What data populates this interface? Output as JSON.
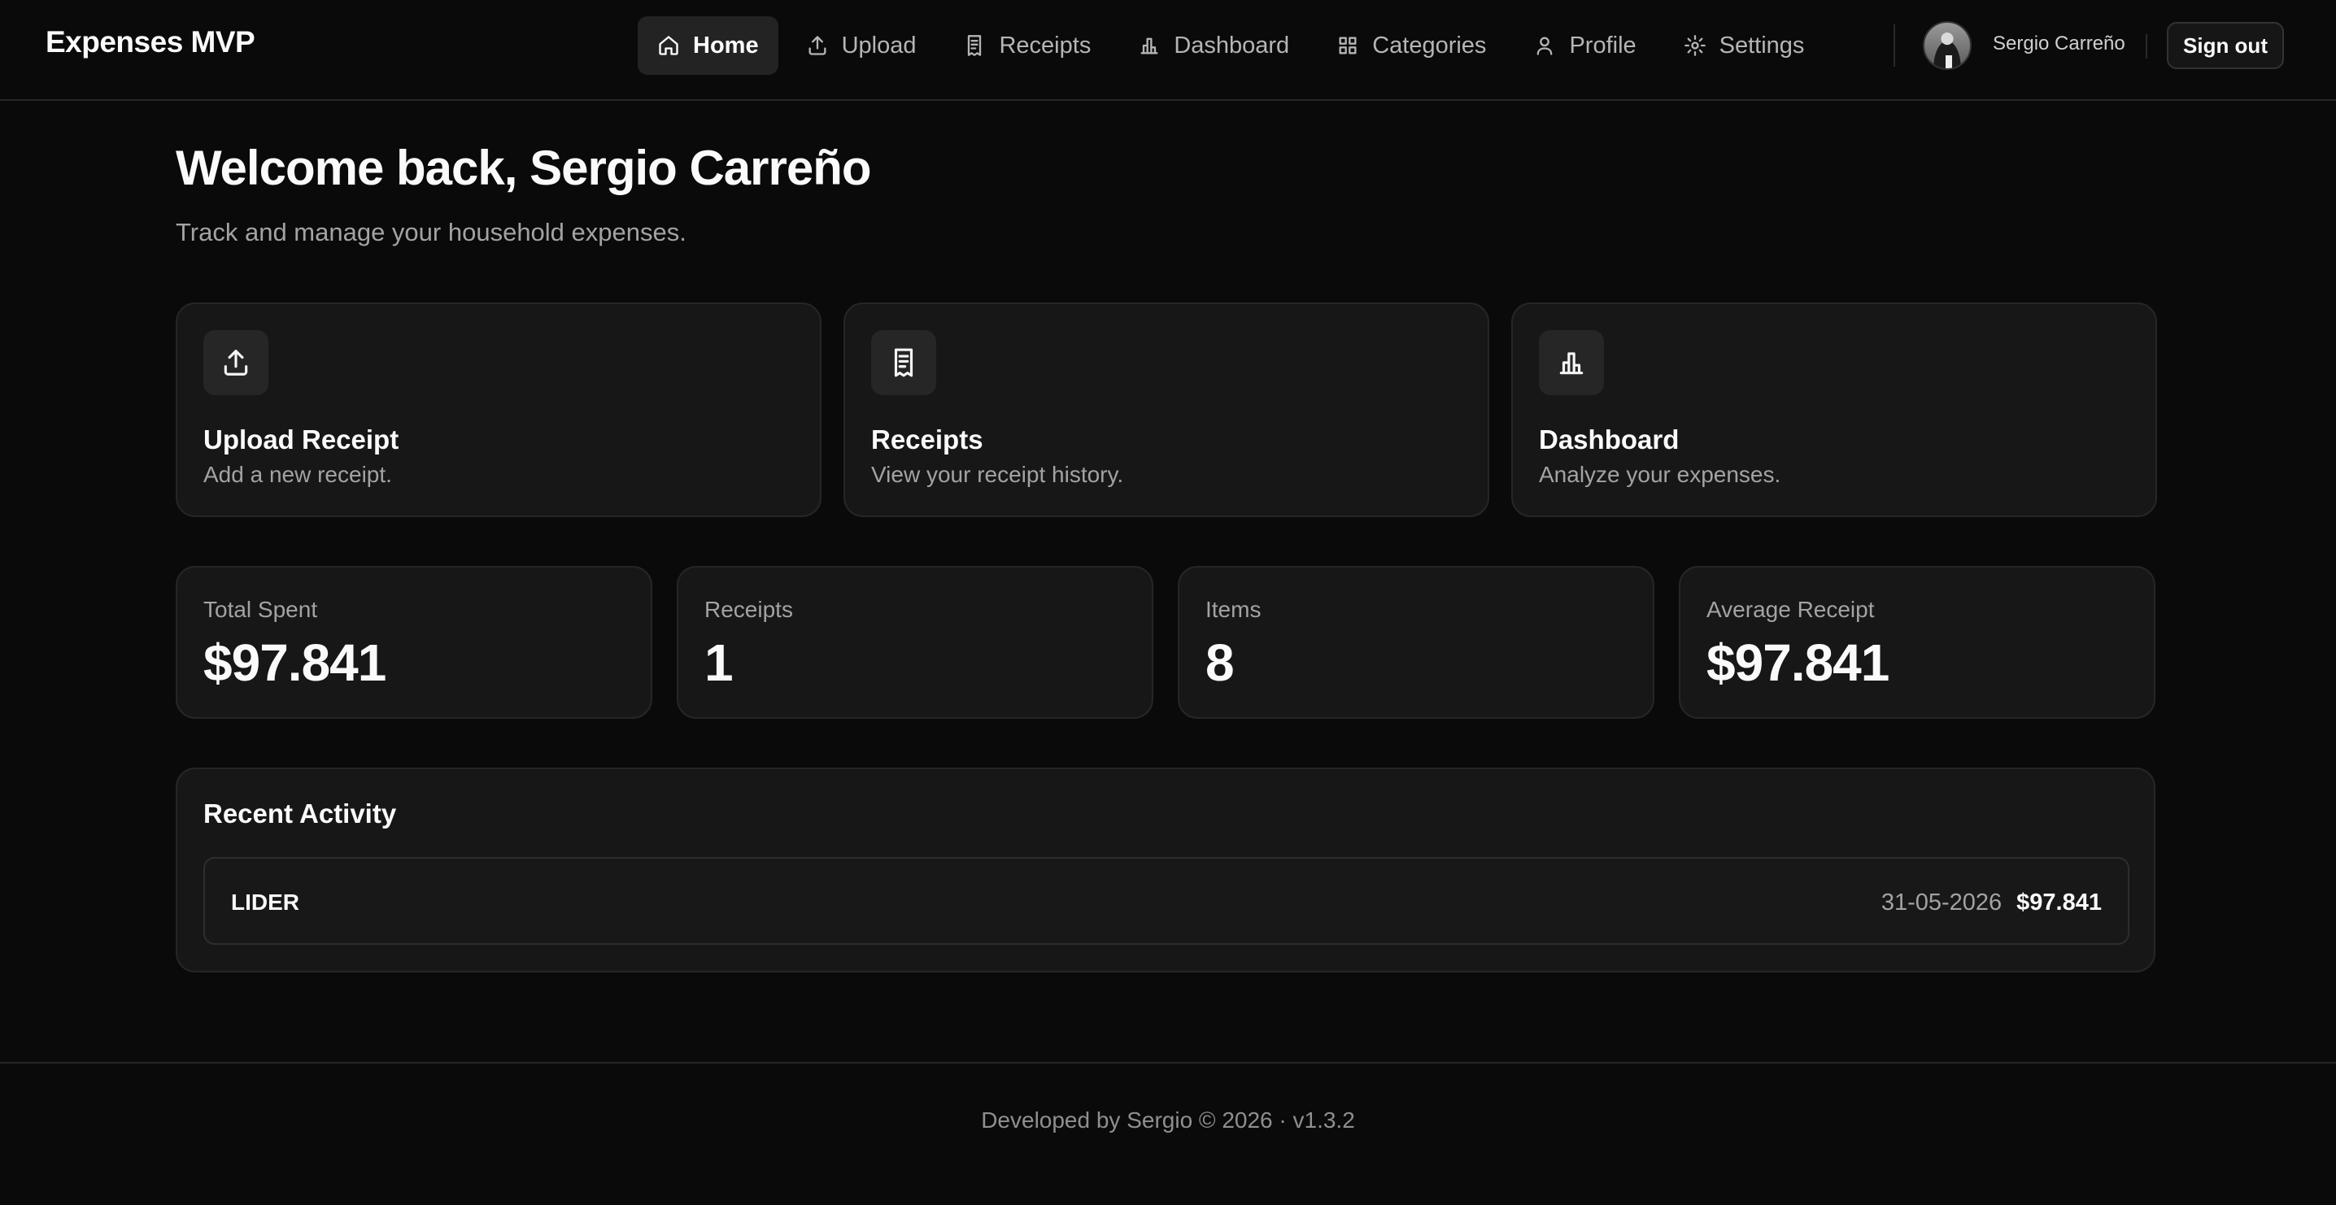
{
  "header": {
    "brand": "Expenses MVP",
    "nav": [
      {
        "label": "Home",
        "icon": "home-icon",
        "active": true
      },
      {
        "label": "Upload",
        "icon": "upload-icon"
      },
      {
        "label": "Receipts",
        "icon": "receipt-icon"
      },
      {
        "label": "Dashboard",
        "icon": "bar-chart-icon"
      },
      {
        "label": "Categories",
        "icon": "grid-icon"
      },
      {
        "label": "Profile",
        "icon": "user-icon"
      },
      {
        "label": "Settings",
        "icon": "gear-icon"
      }
    ],
    "user_name": "Sergio Carreño",
    "sign_out": "Sign out"
  },
  "welcome": {
    "title": "Welcome back, Sergio Carreño",
    "subtitle": "Track and manage your household expenses."
  },
  "actions": [
    {
      "title": "Upload Receipt",
      "description": "Add a new receipt.",
      "icon": "upload-icon"
    },
    {
      "title": "Receipts",
      "description": "View your receipt history.",
      "icon": "receipt-icon"
    },
    {
      "title": "Dashboard",
      "description": "Analyze your expenses.",
      "icon": "bar-chart-icon"
    }
  ],
  "stats": [
    {
      "label": "Total Spent",
      "value": "$97.841"
    },
    {
      "label": "Receipts",
      "value": "1"
    },
    {
      "label": "Items",
      "value": "8"
    },
    {
      "label": "Average Receipt",
      "value": "$97.841"
    }
  ],
  "activity": {
    "title": "Recent Activity",
    "rows": [
      {
        "store": "LIDER",
        "date": "31-05-2026",
        "amount": "$97.841"
      }
    ]
  },
  "footer": {
    "text": "Developed by Sergio © 2026 · v1.3.2"
  },
  "colors": {
    "background": "#0a0a0a",
    "card": "#171717",
    "border": "#262626",
    "text": "#fafafa",
    "muted": "#a3a3a3"
  }
}
